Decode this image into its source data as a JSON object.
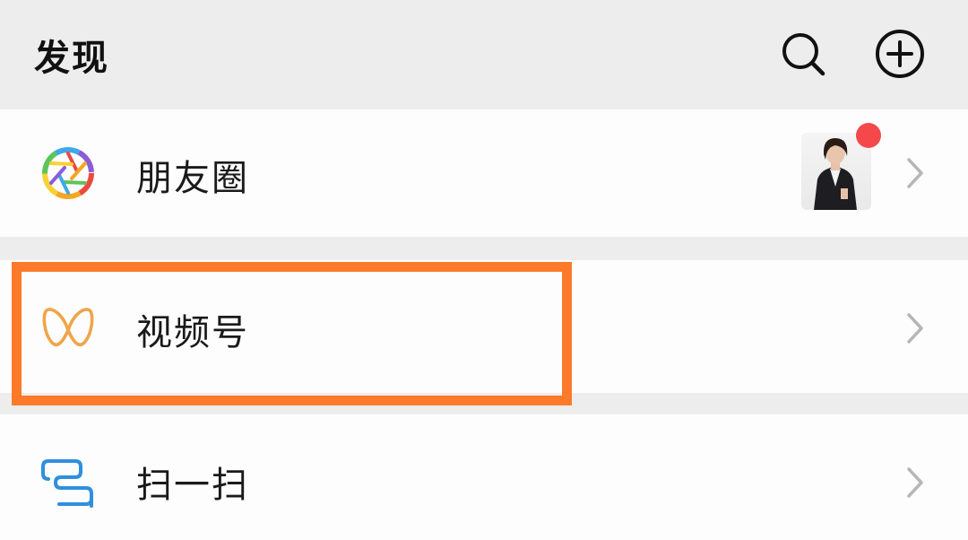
{
  "header": {
    "title": "发现",
    "search_icon": "search-icon",
    "add_icon": "plus-circle-icon"
  },
  "rows": [
    {
      "label": "朋友圈",
      "icon": "moments-aperture-icon",
      "has_thumbnail": true,
      "has_red_dot": true
    },
    {
      "label": "视频号",
      "icon": "channels-butterfly-icon",
      "highlighted": true
    },
    {
      "label": "扫一扫",
      "icon": "scan-icon"
    }
  ],
  "colors": {
    "background": "#ededed",
    "row": "#fdfdfd",
    "highlight": "#fd7a2a",
    "badge": "#f5484b",
    "channels_icon": "#f0a54a",
    "scan_icon": "#2f8fde"
  }
}
